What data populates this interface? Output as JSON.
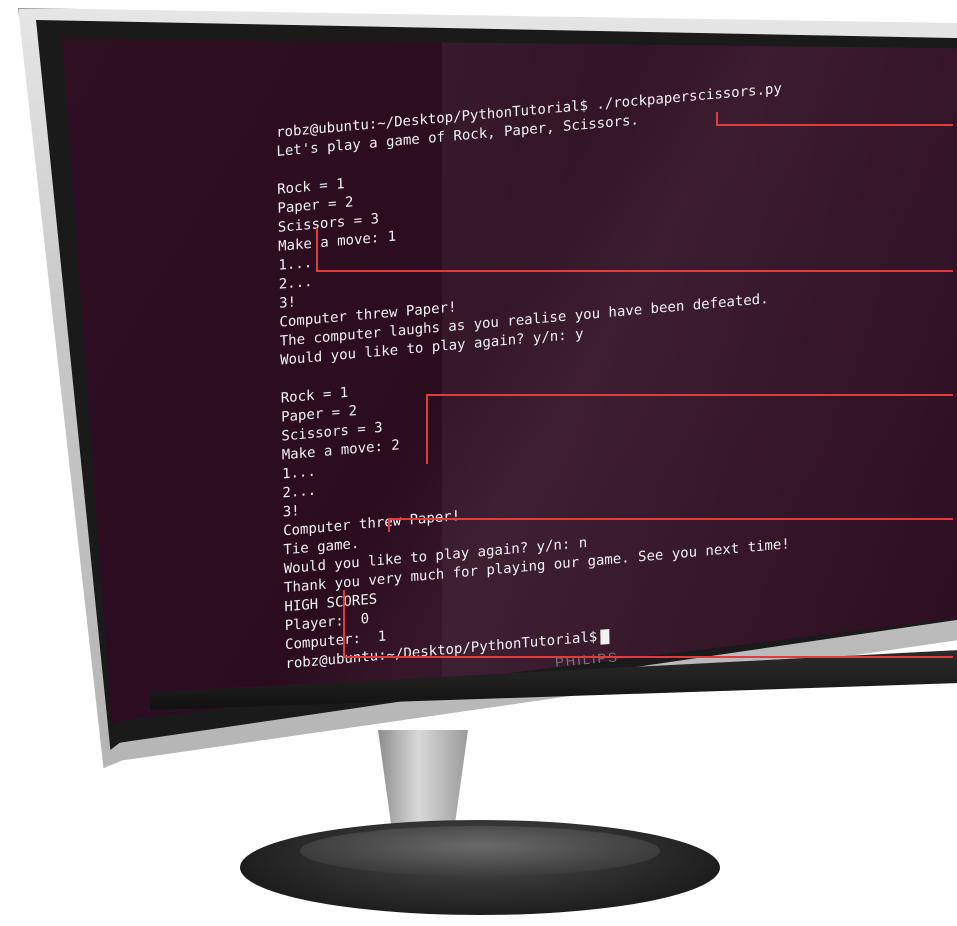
{
  "terminal": {
    "lines": [
      "robz@ubuntu:~/Desktop/PythonTutorial$ ./rockpaperscissors.py",
      "Let's play a game of Rock, Paper, Scissors.",
      "",
      "Rock = 1",
      "Paper = 2",
      "Scissors = 3",
      "Make a move: 1",
      "1...",
      "2...",
      "3!",
      "Computer threw Paper!",
      "The computer laughs as you realise you have been defeated.",
      "Would you like to play again? y/n: y",
      "",
      "Rock = 1",
      "Paper = 2",
      "Scissors = 3",
      "Make a move: 2",
      "1...",
      "2...",
      "3!",
      "Computer threw Paper!",
      "Tie game.",
      "Would you like to play again? y/n: n",
      "Thank you very much for playing our game. See you next time!",
      "HIGH SCORES",
      "Player:  0",
      "Computer:  1",
      "robz@ubuntu:~/Desktop/PythonTutorial$"
    ]
  },
  "monitor": {
    "brand": "PHILIPS"
  },
  "colors": {
    "screen_bg": "#2c0d20",
    "text": "#f2f2f2",
    "callout": "#e23b3b"
  }
}
